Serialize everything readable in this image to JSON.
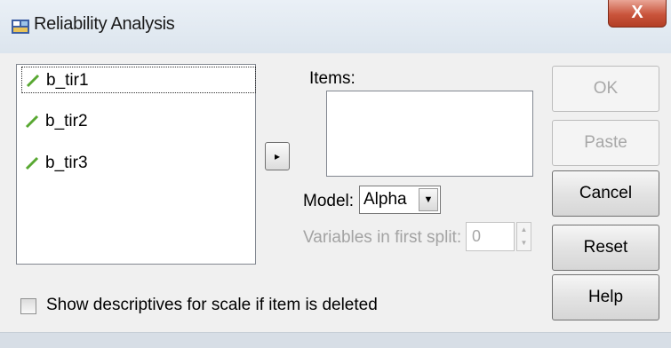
{
  "window": {
    "title": "Reliability Analysis",
    "close_glyph": "X"
  },
  "variables": [
    {
      "name": "b_tir1",
      "icon": "pencil-icon"
    },
    {
      "name": "b_tir2",
      "icon": "pencil-icon"
    },
    {
      "name": "b_tir3",
      "icon": "pencil-icon"
    }
  ],
  "move_button_glyph": "▸",
  "items": {
    "label": "Items:",
    "values": []
  },
  "model": {
    "label": "Model:",
    "value": "Alpha"
  },
  "split": {
    "label": "Variables in first split:",
    "value": "0"
  },
  "buttons": {
    "ok": "OK",
    "paste": "Paste",
    "cancel": "Cancel",
    "reset": "Reset",
    "help": "Help"
  },
  "show_descriptives": {
    "label": "Show descriptives for scale if item is deleted",
    "checked": false
  },
  "colors": {
    "close_button": "#c9543b",
    "pencil": "#58a832",
    "client_bg": "#f0f0f0"
  }
}
